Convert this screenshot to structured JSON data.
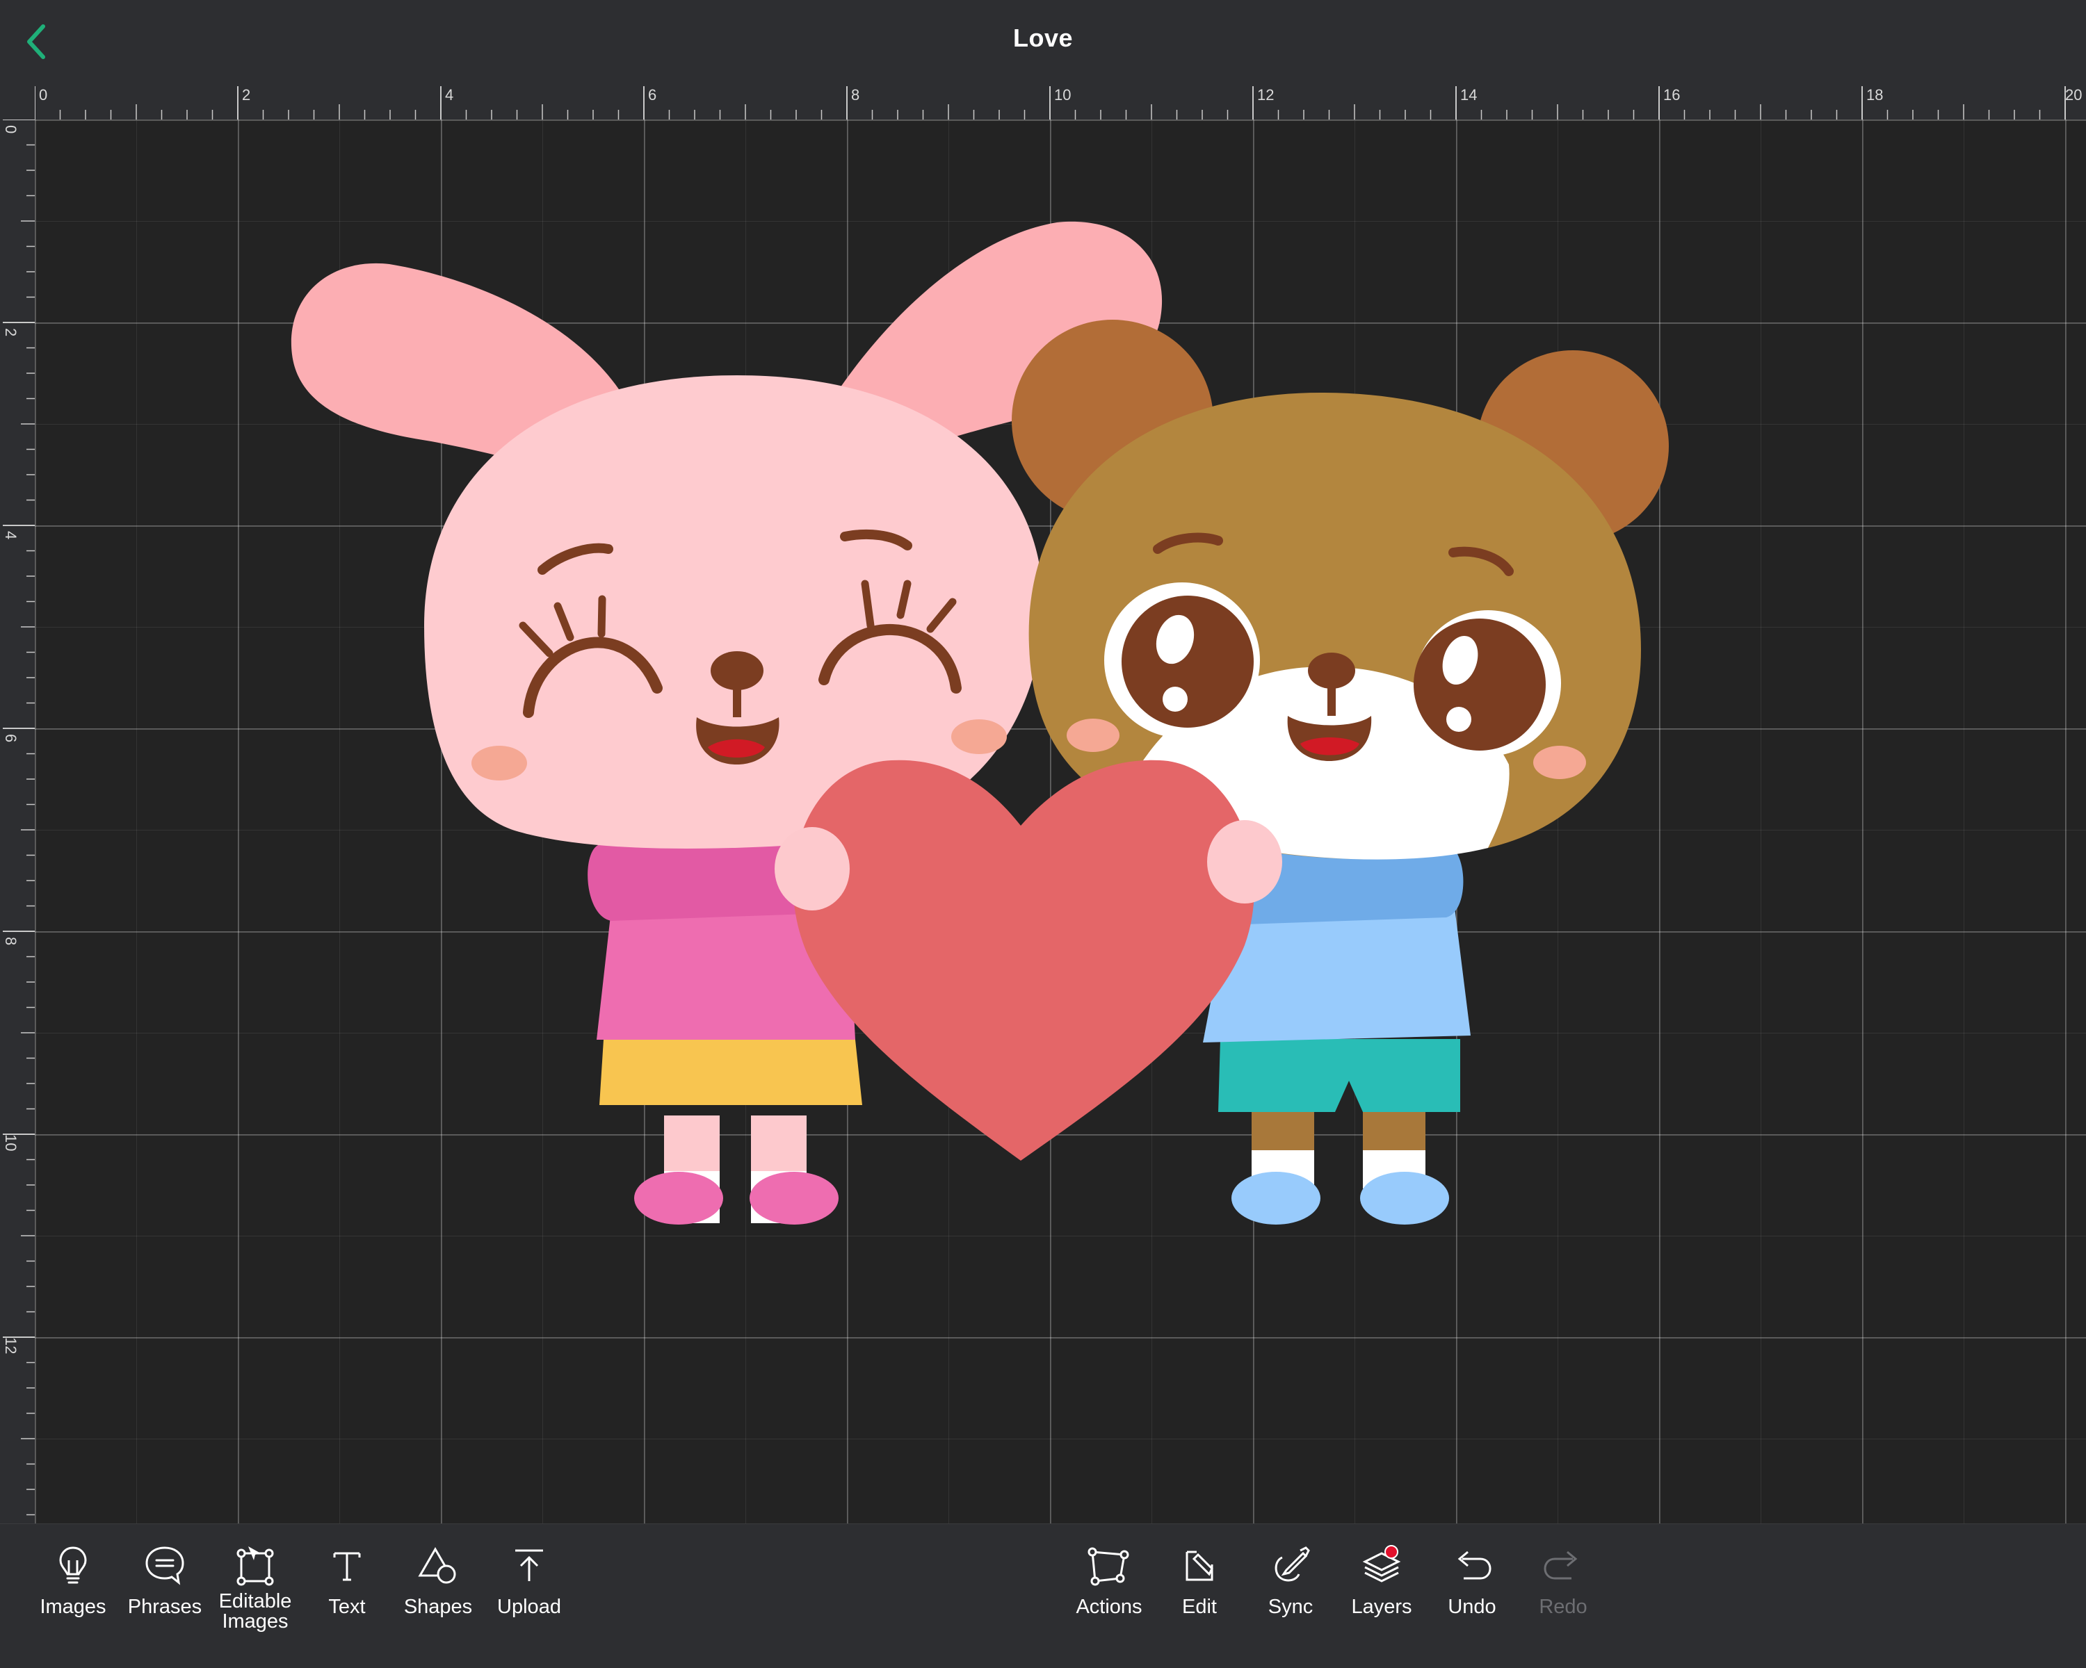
{
  "header": {
    "title": "Love",
    "back_icon": "chevron-left-icon",
    "accent_color": "#1fb079"
  },
  "rulers": {
    "unit_labels_top": [
      "0",
      "2",
      "4",
      "6",
      "8",
      "10",
      "12",
      "14",
      "16",
      "18",
      "20"
    ],
    "unit_labels_left": [
      "0",
      "2",
      "4",
      "6",
      "8",
      "10",
      "12"
    ]
  },
  "canvas": {
    "background_color": "#232323",
    "grid": true,
    "design": {
      "name": "Love",
      "characters": [
        "bunny",
        "bear",
        "heart"
      ],
      "colors": {
        "bunny_face": "#fecbcf",
        "bunny_ear": "#fcaeb3",
        "bear_face": "#b3863e",
        "bear_ear": "#b26d37",
        "heart": "#e46668",
        "pink_shirt": "#ee6db0",
        "yellow_skirt": "#f8c550",
        "blue_shirt": "#98cbfc",
        "teal_shorts": "#29bdb6"
      }
    }
  },
  "toolbar": {
    "left": [
      {
        "label": "Images",
        "icon": "lightbulb-icon"
      },
      {
        "label": "Phrases",
        "icon": "speech-bubble-icon"
      },
      {
        "label": "Editable Images",
        "line1": "Editable",
        "line2": "Images",
        "icon": "editable-image-icon"
      },
      {
        "label": "Text",
        "icon": "text-icon"
      },
      {
        "label": "Shapes",
        "icon": "shapes-icon"
      },
      {
        "label": "Upload",
        "icon": "upload-icon"
      }
    ],
    "right": [
      {
        "label": "Actions",
        "icon": "actions-icon"
      },
      {
        "label": "Edit",
        "icon": "edit-icon"
      },
      {
        "label": "Sync",
        "icon": "sync-icon"
      },
      {
        "label": "Layers",
        "icon": "layers-icon",
        "badge_color": "#e3102c"
      },
      {
        "label": "Undo",
        "icon": "undo-icon"
      },
      {
        "label": "Redo",
        "icon": "redo-icon",
        "disabled": true
      }
    ]
  }
}
